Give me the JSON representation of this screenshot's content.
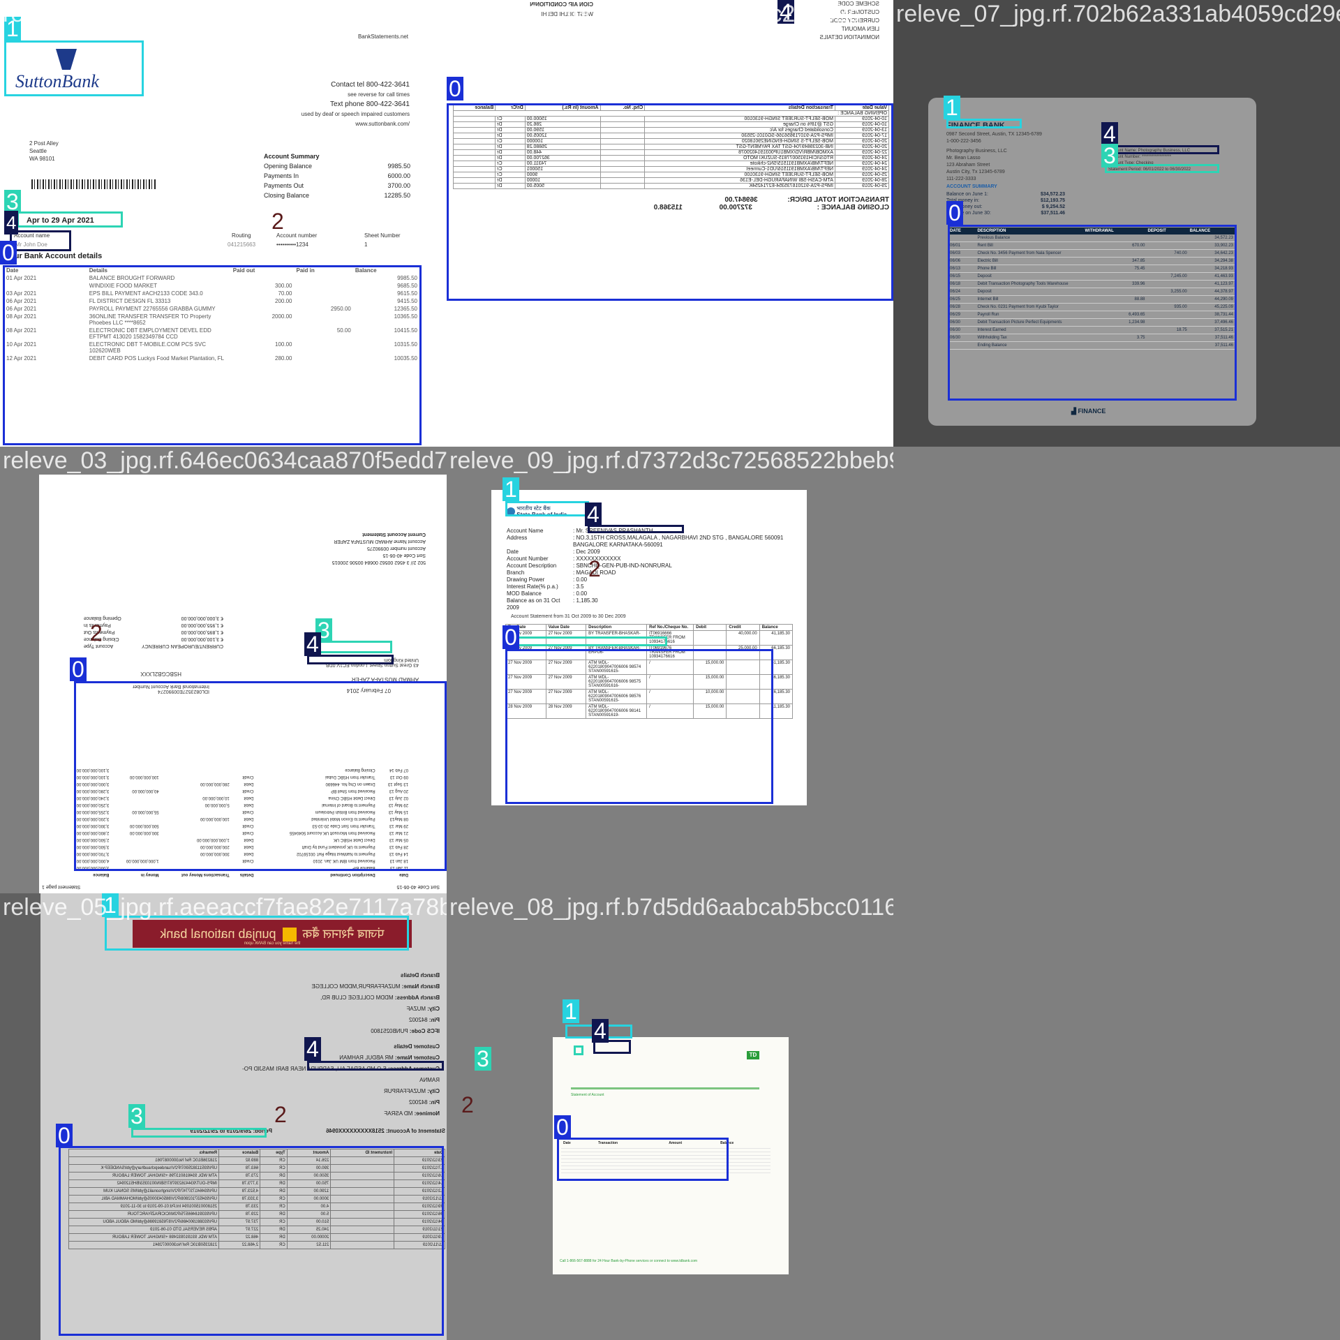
{
  "tiles": [
    {
      "filename": "releve_10_jpg.rf.d5abcd9971f80b43e7e6de",
      "bank_logo": "SuttonBank",
      "site": "BankStatements.net",
      "contact": [
        "Contact tel 800-422-3641",
        "see reverse for call times",
        "Text phone 800-422-3641",
        "used by deaf or speech impaired customers",
        "www.suttonbank.com/"
      ],
      "address": [
        "2 Post Alley",
        "Seattle",
        "WA 98101"
      ],
      "summary_title": "Account Summary",
      "summary": [
        {
          "label": "Opening Balance",
          "value": "9985.50"
        },
        {
          "label": "Payments In",
          "value": "6000.00"
        },
        {
          "label": "Payments Out",
          "value": "3700.00"
        },
        {
          "label": "Closing Balance",
          "value": "12285.50"
        }
      ],
      "period": "Apr to 29 Apr 2021",
      "routing_label": "Routing",
      "routing": "041215663",
      "account_name_label": "Account name",
      "account_name": "Mr John Doe",
      "account_number_label": "Account number",
      "account_number": "••••••••••1234",
      "sheet_number_label": "Sheet Number",
      "sheet_number": "1",
      "details_title": "our Bank Account details",
      "columns": [
        "Date",
        "Details",
        "Paid out",
        "Paid in",
        "Balance"
      ],
      "rows": [
        [
          "01 Apr 2021",
          "BALANCE BROUGHT FORWARD",
          "",
          "",
          "9985.50"
        ],
        [
          "",
          "WINDIXIE FOOD MARKET",
          "300.00",
          "",
          "9685.50"
        ],
        [
          "03 Apr 2021",
          "EPS BILL PAYMENT #ACH2133 CODE 343.0",
          "70.00",
          "",
          "9615.50"
        ],
        [
          "06 Apr 2021",
          "FL DISTRICT DESIGN FL 33313",
          "200.00",
          "",
          "9415.50"
        ],
        [
          "06 Apr 2021",
          "PAYROLL PAYMENT 22765556 GRABBA GUMMY",
          "",
          "2950.00",
          "12365.50"
        ],
        [
          "08 Apr 2021",
          "36ONLINE TRANSFER TRANSFER TO Property Phoebes LLC ****8652",
          "2000.00",
          "",
          "10365.50"
        ],
        [
          "08 Apr 2021",
          "ELECTRONIC DBT EMPLOYMENT DEVEL EDD EFTPMT 413020 1582349784 CCD",
          "",
          "50.00",
          "10415.50"
        ],
        [
          "10 Apr 2021",
          "ELECTRONIC DBT T-MOBILE.COM PCS SVC 102620WEB",
          "100.00",
          "",
          "10315.50"
        ],
        [
          "12 Apr 2021",
          "DEBIT CARD POS Luckys Food Market Plantation, FL",
          "280.00",
          "",
          "10035.50"
        ]
      ]
    },
    {
      "filename": "releve_01_jpg.rf.8353370435cc23082c",
      "header_lines": [
        "SCHEME CODE",
        "CUSTOMER ID",
        "CURRENCY CODE",
        "LIEN AMOUNT",
        "NOMINATION DETAILS"
      ],
      "header_right": [
        "CION AIR CONDITIONIN",
        "WEST DELHI DELHI"
      ],
      "columns": [
        "Value Date",
        "Transaction Details",
        "Chq. No.",
        "Amount (In Rs.)",
        "Dr/Cr",
        "Balance"
      ],
      "opening": "OPENING BALANCE :",
      "rows": [
        [
          "10-04-2019",
          "MOB-SELFT-SURJEET SINGH-9130100",
          "",
          "15000.00",
          "Cr",
          ""
        ],
        [
          "10-04-2019",
          "GST @18% on Charge",
          "",
          "286.20",
          "Dr",
          ""
        ],
        [
          "13-04-2019",
          "Consolidated Charges for A/c",
          "",
          "1590.00",
          "Dr",
          ""
        ],
        [
          "17-04-2019",
          "IMPS-P2A-910719656166-SG0101-25530",
          "",
          "12005.00",
          "Dr",
          ""
        ],
        [
          "20-04-2019",
          "MOB-SELFT-S SINGH-ENGINE29018020",
          "",
          "100000",
          "Cr",
          ""
        ],
        [
          "20-04-2019",
          "INB-30239849704-GST TAX PAYMENT-GST",
          "",
          "26880.28",
          "Dr",
          ""
        ],
        [
          "22-04-2019",
          "AXMOB/MBR/VD/XMB1UP0031914020078",
          "",
          "448.00",
          "Dr",
          ""
        ],
        [
          "24-04-2019",
          "RTGS/ICIH19150077815-SUZUKI MOTO",
          "",
          "362700.00",
          "Dr",
          ""
        ],
        [
          "24-04-2019",
          "NEFT/MB/AXMB1911515/SN2-chikote",
          "",
          "74311.00",
          "Cr",
          ""
        ],
        [
          "24-04-2019",
          "NEFT/MB/AXMB1911516/UD1-Curmeet",
          "",
          "150001",
          "Cr",
          ""
        ],
        [
          "25-04-2019",
          "MOB-SELFT-SURJEET SINGH-9130100",
          "",
          "9000",
          "Cr",
          ""
        ],
        [
          "28-04-2019",
          "ATM-CASH-SBI WINAFARUGH-DEL-E136",
          "",
          "10000",
          "Dr",
          ""
        ],
        [
          "29-04-2019",
          "IMPS-P2A-912016735354-E2714254K",
          "",
          "5005.00",
          "Dr",
          ""
        ]
      ],
      "total_label": "TRANSACTION TOTAL DR/CR:",
      "total_dr": "369847.00",
      "total_cr": "372700.00",
      "closing_label": "CLOSING BALANCE :",
      "closing": "115368.0"
    },
    {
      "filename": "releve_07_jpg.rf.702b62a331ab4059cd29eb",
      "bank": "FINANCE BANK",
      "bank_address": [
        "0987 Second Street, Austin, TX 12345-6789",
        "1-000-222-3456"
      ],
      "customer": [
        "Photography Business, LLC",
        "Mr. Bean Lasso",
        "123 Abraham Street",
        "Austin City, Tx 12345-6789",
        "111-222-3333"
      ],
      "right_info": [
        "Account Name: Photography Business, LLC",
        "Account Number: ******************",
        "Account Type: Checking",
        "Statement Period: 06/01/2022 to 06/30/2022"
      ],
      "summary_title": "ACCOUNT SUMMARY",
      "summary": [
        {
          "label": "Balance on June 1:",
          "value": "$34,572.23"
        },
        {
          "label": "Total money in:",
          "value": "$12,193.75"
        },
        {
          "label": "Total money out:",
          "value": "$ 9,254.52"
        },
        {
          "label": "Balance on June 30:",
          "value": "$37,511.46"
        }
      ],
      "columns": [
        "DATE",
        "DESCRIPTION",
        "WITHDRAWAL",
        "DEPOSIT",
        "BALANCE"
      ],
      "rows": [
        [
          "",
          "Previous Balance",
          "",
          "",
          "34,572.23"
        ],
        [
          "06/01",
          "Rent Bill",
          "670.00",
          "",
          "33,902.23"
        ],
        [
          "06/03",
          "Check No. 3456 Payment from Nala Spencer",
          "",
          "740.00",
          "34,642.23"
        ],
        [
          "06/06",
          "Electric Bill",
          "347.85",
          "",
          "34,294.38"
        ],
        [
          "06/13",
          "Phone Bill",
          "75.45",
          "",
          "34,218.93"
        ],
        [
          "06/15",
          "Deposit",
          "",
          "7,245.00",
          "41,463.93"
        ],
        [
          "06/18",
          "Debit Transaction Photography Tools Warehouse",
          "339.96",
          "",
          "41,123.97"
        ],
        [
          "06/24",
          "Deposit",
          "",
          "3,255.00",
          "44,378.97"
        ],
        [
          "06/25",
          "Internet Bill",
          "88.88",
          "",
          "44,290.09"
        ],
        [
          "06/28",
          "Check No. 0231 Payment from Kyubi Taylor",
          "",
          "935.00",
          "45,225.09"
        ],
        [
          "06/29",
          "Payroll Run",
          "6,493.65",
          "",
          "38,731.44"
        ],
        [
          "06/30",
          "Debit Transaction Picture Perfect Equipments",
          "1,234.98",
          "",
          "37,496.46"
        ],
        [
          "06/30",
          "Interest Earned",
          "",
          "18.75",
          "37,515.21"
        ],
        [
          "06/30",
          "Withholding Tax",
          "3.75",
          "",
          "37,511.46"
        ],
        [
          "",
          "Ending Balance",
          "",
          "",
          "37,511.46"
        ]
      ],
      "footer_logo": "FINANCE"
    },
    {
      "filename": "releve_03_jpg.rf.646ec0634caa870f5edd7e",
      "header_title": "Current Account Statement",
      "header_lines": [
        "Account Name AHMAD MUSTAFA ZAFER",
        "Account number 00990275",
        "Sort Code 40-06-15"
      ],
      "header_code": "502 2// 3 4562 00562 00684 00506 200015",
      "summary": [
        {
          "label": "Opening Balance",
          "value": "€ 3,000,000,000.00"
        },
        {
          "label": "Payments In",
          "value": "€ 1,955,000,000.00"
        },
        {
          "label": "Payments Out",
          "value": "€ 1,895,000,000.00"
        },
        {
          "label": "Closing Balance",
          "value": "€ 3,100,000,000.00"
        },
        {
          "label": "Account Type",
          "value": "CURRENT/EUROPEAN CURRENCY"
        }
      ],
      "iban_label": "International Bank Account Number",
      "iban": "IDL0823527E00990274",
      "swift": "HSBCGB2LXXX",
      "date_text": "07 February 2014",
      "name_text": "AHMAD MUSTAFA ZAFER",
      "address_text": "43 Great Sutton Street, London EC1V 0DB, United Kingdom",
      "columns": [
        "Date",
        "Description Continued",
        "Details",
        "Transactions Money out",
        "Money in",
        "Balance"
      ],
      "rows": [
        [
          "11 Jan 13",
          "Balance B/F",
          "",
          "",
          "",
          "3,000,000,000.00"
        ],
        [
          "18 Jan 13",
          "Received from IBM UK Jan. 2010",
          "Credit",
          "",
          "1,000,000,000.00",
          "4,000,000,000.00"
        ],
        [
          "14 Feb 13",
          "Payment to NatWest Mage Ref: 00159702",
          "Debit",
          "300,000,000.00",
          "",
          "3,700,000,000.00"
        ],
        [
          "28 Feb 13",
          "Payment to UK provident Fund by Draft",
          "Debit",
          "200,000,000.00",
          "",
          "3,500,000,000.00"
        ],
        [
          "05 Mar 13",
          "Direct Debit HSBC UK",
          "Debit",
          "1,000,000,000.00",
          "",
          "2,500,000,000.00"
        ],
        [
          "21 Mar 13",
          "Received from Microsoft UK Account 5040455",
          "Credit",
          "",
          "300,000,000.00",
          "2,800,000,000.00"
        ],
        [
          "29 Mar 13",
          "Transfer from Sort Code 20-10-53",
          "Credit",
          "",
          "500,000,000.00",
          "3,300,000,000.00"
        ],
        [
          "08 May13",
          "Payment to Exxon Mobil Unlimited",
          "Debit",
          "100,000,000.00",
          "",
          "3,200,000,000.00"
        ],
        [
          "15 May 13",
          "Received from British Petroleum",
          "Credit",
          "",
          "55,000,000.00",
          "3,255,000,000.00"
        ],
        [
          "29 May 13",
          "Payment to Board of Internal",
          "Debit",
          "5,000,000.00",
          "",
          "3,250,000,000.00"
        ],
        [
          "02 July 13",
          "Direct Debit HSBC China",
          "Debit",
          "10,000,000.00",
          "",
          "3,240,000,000.00"
        ],
        [
          "20 Aug 13",
          "Received from Shell BP",
          "Credit",
          "",
          "40,000,000.00",
          "3,280,000,000.00"
        ],
        [
          "13 Sept 13",
          "Drawn on Chq No. 446690",
          "Debit",
          "280,000,000.00",
          "",
          "3,000,000,000.00"
        ],
        [
          "09 Oct 13",
          "Transfer from HSBC Dubai",
          "Credit",
          "",
          "100,000,000.00",
          "3,100,000,000.00"
        ],
        [
          "07 Feb 14",
          "Closing Balance",
          "",
          "",
          "",
          "3,100,000,000.00"
        ]
      ],
      "footer": [
        "Sort Code 40-06-15",
        "Statement page 1"
      ]
    },
    {
      "filename": "releve_09_jpg.rf.d7372d3c72568522bbeb91f",
      "bank_name": "State Bank of India",
      "bank_name_local": "भारतीय स्टेट बैंक",
      "fields": [
        {
          "label": "Account Name",
          "value": "Mr. SREENIVAS PRASHANTH"
        },
        {
          "label": "Address",
          "value": "NO.3,15TH CROSS,MALAGALA , NAGARBHAVI 2ND STG , BANGALORE 560091 BANGALORE KARNATAKA-560091"
        },
        {
          "label": "Date",
          "value": "Dec 2009"
        },
        {
          "label": "Account Number",
          "value": "XXXXXXXXXXXX"
        },
        {
          "label": "Account Description",
          "value": "SBNCHQ-GEN-PUB-IND-NONRURAL"
        },
        {
          "label": "Branch",
          "value": "MAGADI ROAD"
        },
        {
          "label": "Drawing Power",
          "value": "0.00"
        },
        {
          "label": "Interest Rate(% p.a.)",
          "value": "3.5"
        },
        {
          "label": "MOD Balance",
          "value": "0.00"
        },
        {
          "label": "Balance as on 31 Oct 2009",
          "value": "1,185.30"
        }
      ],
      "statement_title": "Account Statement from 31 Oct 2009 to 30 Dec 2009",
      "columns": [
        "Txn Date",
        "Value Date",
        "Description",
        "Ref No./Cheque No.",
        "Debit",
        "Credit",
        "Balance"
      ],
      "rows": [
        [
          "27 Nov 2009",
          "27 Nov 2009",
          "BY TRANSFER-BHASKAR-",
          "IT06916666 TRANSFER FROM 10934176616",
          "",
          "40,000.00",
          "41,185.30"
        ],
        [
          "27 Nov 2009",
          "27 Nov 2009",
          "BY TRANSFER-BHASKAR-ERPU6-",
          "IT06919676 TRANSFER FROM 10934176616",
          "",
          "25,000.00",
          "66,185.30"
        ],
        [
          "27 Nov 2009",
          "27 Nov 2009",
          "ATM WDL-62201809047006006 98574 STAN00591615-",
          "/",
          "15,000.00",
          "",
          "51,185.30"
        ],
        [
          "27 Nov 2009",
          "27 Nov 2009",
          "ATM WDL-62201809047006006 98575 STAN00591616-",
          "/",
          "15,000.00",
          "",
          "36,185.30"
        ],
        [
          "27 Nov 2009",
          "27 Nov 2009",
          "ATM WDL-62201809047006006 98576 STAN00591615-",
          "/",
          "10,000.00",
          "",
          "26,185.30"
        ],
        [
          "28 Nov 2009",
          "28 Nov 2009",
          "ATM WDL-62201809047006006 98141 STAN00591619-",
          "/",
          "15,000.00",
          "",
          "11,185.30"
        ]
      ]
    },
    {
      "filename": "releve_05_jpg.rf.aeeaccf7fae82e7117a78b0",
      "bank_name": "punjab national bank",
      "bank_name_local": "पंजाब नैशनल बैंक",
      "bank_tagline": "the name you can BANK upon",
      "branch_title": "Branch Details",
      "branch": [
        {
          "label": "Branch Name:",
          "value": "MUZAFFARPUR,MDDM COLLEGE"
        },
        {
          "label": "Branch Address:",
          "value": "MDDM COLLEGE CLUB RD,"
        },
        {
          "label": "City:",
          "value": "MUZAF"
        },
        {
          "label": "Pin:",
          "value": "842002"
        },
        {
          "label": "IFCS Code:",
          "value": "PUNB0251800"
        }
      ],
      "customer_title": "Customer Details",
      "customer": [
        {
          "label": "Customer Name:",
          "value": "MR ABDUL RAHMAN"
        },
        {
          "label": "Customer Address:",
          "value": "S O MD ASRAF ALI, SADPURA NEAR BARI MASJID PO-RAMNA"
        },
        {
          "label": "City:",
          "value": "MUZAFFARPUR"
        },
        {
          "label": "Pin:",
          "value": "842002"
        },
        {
          "label": "Nominee:",
          "value": "MD ASRAF"
        }
      ],
      "statement_label": "Statement of Account: 2518XXXXXXXXX0946",
      "period": "Period: 26/9/2019 to 25/12/2019",
      "columns": [
        "Date",
        "Instrument ID",
        "Amount",
        "Type",
        "Balance",
        "Remarks"
      ],
      "rows": [
        [
          "23/12/2019",
          "",
          "226.14",
          "CR",
          "889.92",
          "218236B10C Ref No3000087061"
        ],
        [
          "17/12/2019",
          "",
          "390.00",
          "CR",
          "663.78",
          "UPI/935113825907/P2V/sandeepchaudhary@ybl/SANDEEP K"
        ],
        [
          "16/12/2019",
          "",
          "3500.00",
          "DR",
          "273.78",
          "ATM WDL 934616013796 +SINGHAL TOWER LABOUR"
        ],
        [
          "14/12/2019",
          "",
          "750.00",
          "DR",
          "3,773.78",
          "IMPS-OUT/934416239787/SBIN0010353/BH5120942"
        ],
        [
          "12/12/2019",
          "",
          "1290.00",
          "DR",
          "4,523.78",
          "UPI/934641737747/P2V/singhsonali1@ybl/MS SONALI KUM"
        ],
        [
          "11/12/2019",
          "",
          "3000.00",
          "CR",
          "3,333.78",
          "UPI/934537102808/P2V/8650430005@ybl/MOHAMMAD ABIL"
        ],
        [
          "09/12/2019",
          "",
          "4.00",
          "CR",
          "233.78",
          "251800015001094 Int.Pd:01-09-2019 to 30-11-2019"
        ],
        [
          "06/12/2019",
          "",
          "5.00",
          "DR",
          "229.78",
          "UPI/933918466575/P2M/ICICIRAZP/ARCTOUR"
        ],
        [
          "04/12/2019",
          "",
          "510.00",
          "CR",
          "737.97",
          "UPI/933881900486/P2V/8765819986@ybl/MD ABDUL ABDU"
        ],
        [
          "21/11/2019",
          "",
          "240.25",
          "DR",
          "227.97",
          "APBS REVERSAL DTD 01-06-2019"
        ],
        [
          "19/11/2019",
          "",
          "20000.00",
          "DR",
          "468.22",
          "ATM WDL 931910932498 +SINGHAL TOWER LABOUR"
        ],
        [
          "11/11/2019",
          "",
          "211.52",
          "CR",
          "2,468.22",
          "2182350B10C Ref No3000072841"
        ]
      ]
    },
    {
      "filename": "releve_08_jpg.rf.b7d5dd6aabcab5bcc011695",
      "logo": "TD",
      "green_heading": "Statement of Account",
      "columns": [
        "Date",
        "Transaction",
        "Amount",
        "Balance"
      ],
      "footer": "Call 1-866-567-8888 for 24 Hour Bank-by-Phone services or connect to www.tdbank.com"
    }
  ]
}
